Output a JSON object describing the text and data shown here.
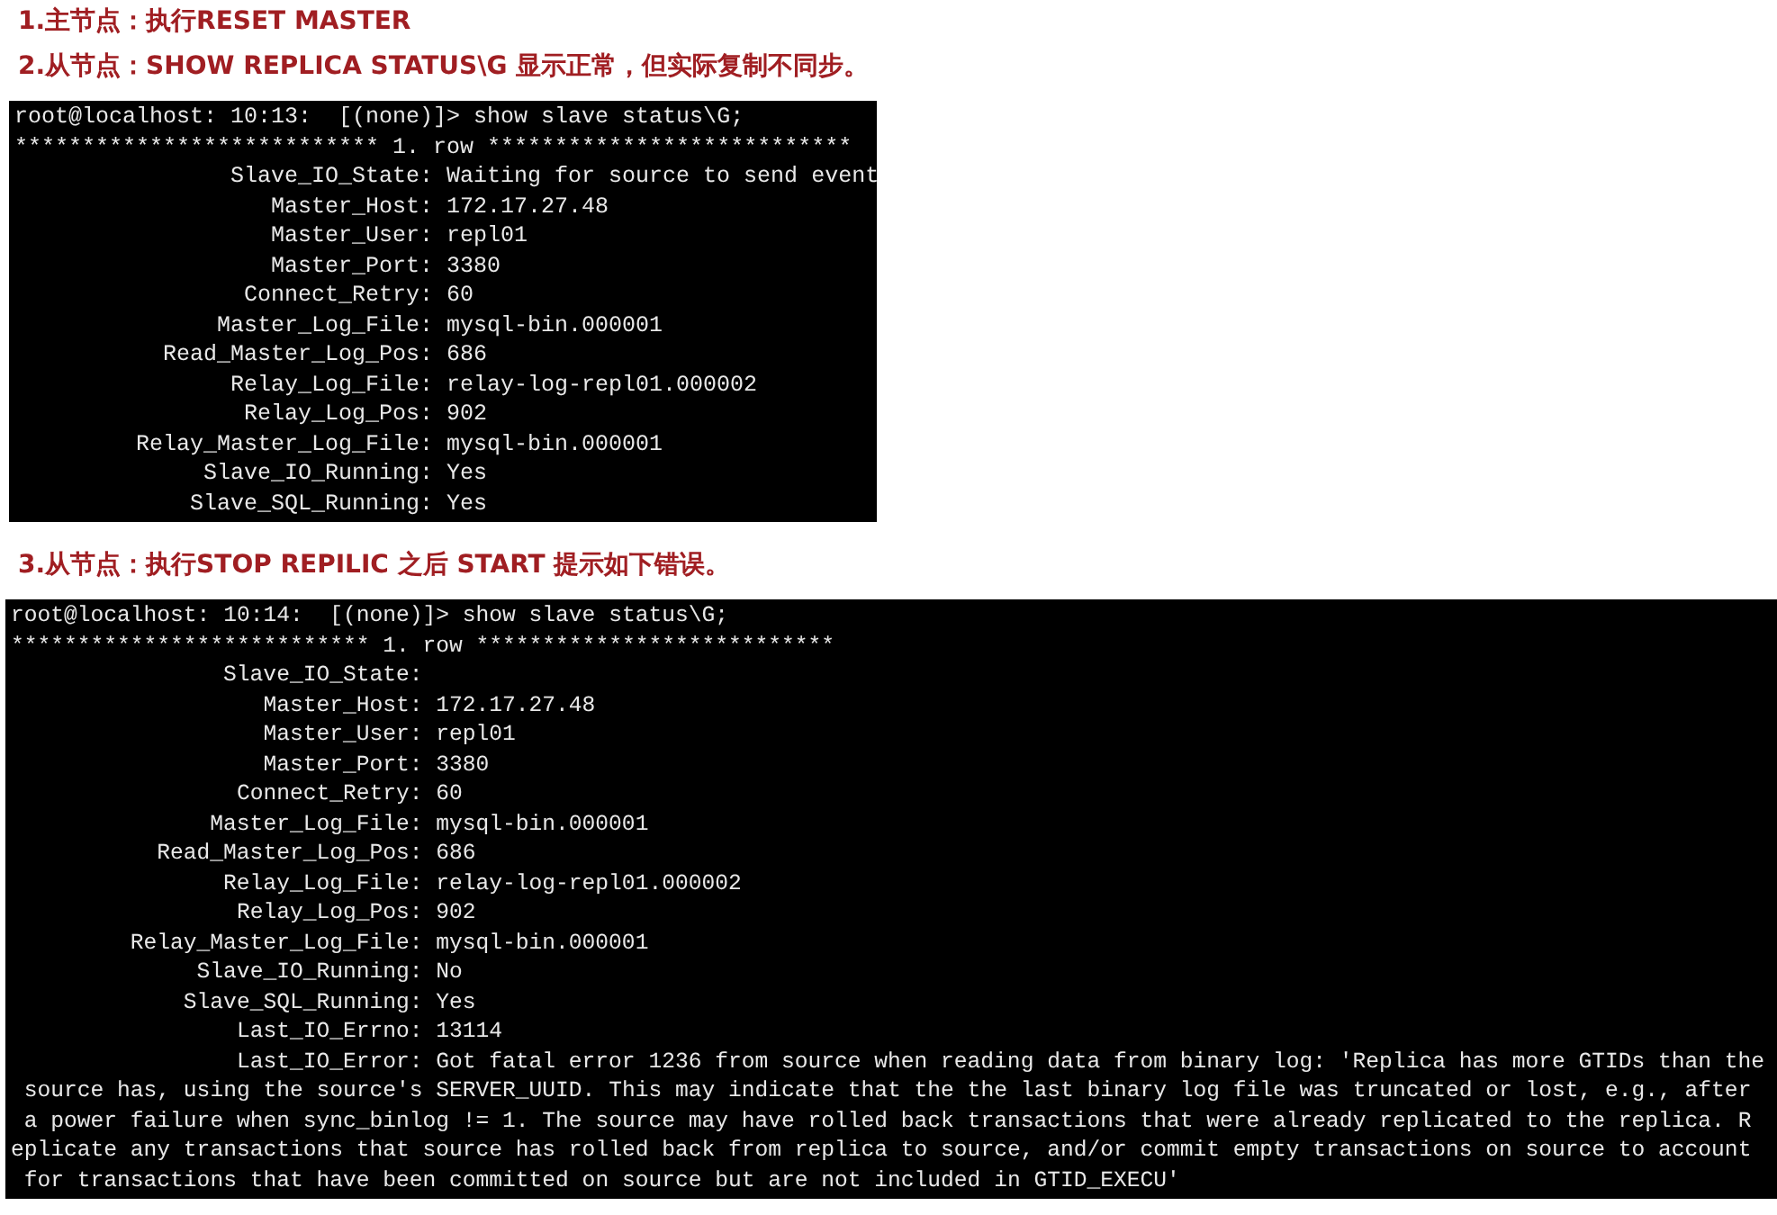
{
  "steps": [
    {
      "heading": "1.主节点：执行RESET MASTER"
    },
    {
      "heading": "2.从节点：SHOW REPLICA STATUS\\G 显示正常，但实际复制不同步。",
      "terminal": {
        "prompt": "root@localhost: 10:13:  [(none)]> show slave status\\G;",
        "banner": "*************************** 1. row ***************************",
        "fields": [
          {
            "key": "Slave_IO_State:",
            "value": "Waiting for source to send event"
          },
          {
            "key": "Master_Host:",
            "value": "172.17.27.48"
          },
          {
            "key": "Master_User:",
            "value": "repl01"
          },
          {
            "key": "Master_Port:",
            "value": "3380"
          },
          {
            "key": "Connect_Retry:",
            "value": "60"
          },
          {
            "key": "Master_Log_File:",
            "value": "mysql-bin.000001"
          },
          {
            "key": "Read_Master_Log_Pos:",
            "value": "686"
          },
          {
            "key": "Relay_Log_File:",
            "value": "relay-log-repl01.000002"
          },
          {
            "key": "Relay_Log_Pos:",
            "value": "902"
          },
          {
            "key": "Relay_Master_Log_File:",
            "value": "mysql-bin.000001"
          },
          {
            "key": "Slave_IO_Running:",
            "value": "Yes"
          },
          {
            "key": "Slave_SQL_Running:",
            "value": "Yes"
          }
        ]
      }
    },
    {
      "heading": "3.从节点：执行STOP REPILIC 之后 START 提示如下错误。",
      "terminal": {
        "prompt": "root@localhost: 10:14:  [(none)]> show slave status\\G;",
        "banner": "*************************** 1. row ***************************",
        "fields": [
          {
            "key": "Slave_IO_State:"
          },
          {
            "key": "Master_Host:",
            "value": "172.17.27.48"
          },
          {
            "key": "Master_User:",
            "value": "repl01"
          },
          {
            "key": "Master_Port:",
            "value": "3380"
          },
          {
            "key": "Connect_Retry:",
            "value": "60"
          },
          {
            "key": "Master_Log_File:",
            "value": "mysql-bin.000001"
          },
          {
            "key": "Read_Master_Log_Pos:",
            "value": "686"
          },
          {
            "key": "Relay_Log_File:",
            "value": "relay-log-repl01.000002"
          },
          {
            "key": "Relay_Log_Pos:",
            "value": "902"
          },
          {
            "key": "Relay_Master_Log_File:",
            "value": "mysql-bin.000001"
          },
          {
            "key": "Slave_IO_Running:",
            "value": "No"
          },
          {
            "key": "Slave_SQL_Running:",
            "value": "Yes"
          },
          {
            "key": "Last_IO_Errno:",
            "value": "13114"
          },
          {
            "key": "Last_IO_Error:",
            "value": "Got fatal error 1236 from source when reading data from binary log: 'Replica has more GTIDs than the"
          }
        ],
        "continuation": [
          " source has, using the source's SERVER_UUID. This may indicate that the the last binary log file was truncated or lost, e.g., after",
          " a power failure when sync_binlog != 1. The source may have rolled back transactions that were already replicated to the replica. R",
          "eplicate any transactions that source has rolled back from replica to source, and/or commit empty transactions on source to account",
          " for transactions that have been committed on source but are not included in GTID_EXECU'"
        ]
      }
    }
  ]
}
